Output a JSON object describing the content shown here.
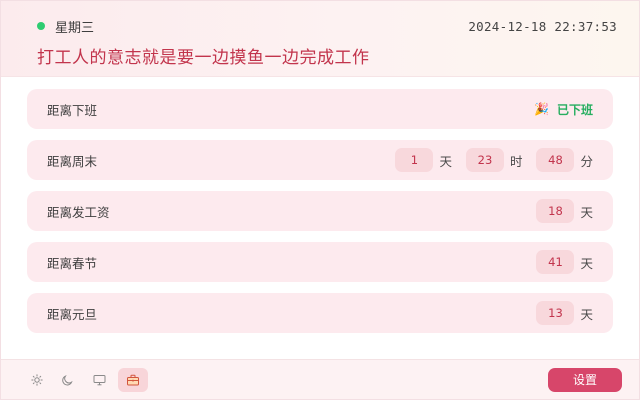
{
  "header": {
    "day": "星期三",
    "datetime": "2024-12-18 22:37:53",
    "slogan": "打工人的意志就是要一边摸鱼一边完成工作"
  },
  "rows": [
    {
      "label": "距离下班",
      "status_icon": "🎉",
      "status": "已下班"
    },
    {
      "label": "距离周末",
      "days": "1",
      "days_unit": "天",
      "hours": "23",
      "hours_unit": "时",
      "minutes": "48",
      "minutes_unit": "分"
    },
    {
      "label": "距离发工资",
      "value": "18",
      "unit": "天"
    },
    {
      "label": "距离春节",
      "value": "41",
      "unit": "天"
    },
    {
      "label": "距离元旦",
      "value": "13",
      "unit": "天"
    }
  ],
  "footer": {
    "theme_icons": [
      "sun-icon",
      "moon-icon",
      "monitor-icon",
      "briefcase-icon"
    ],
    "settings_label": "设置"
  },
  "colors": {
    "accent": "#d7466a",
    "slogan": "#c2344c",
    "status_green": "#27ae60",
    "row_bg": "#fdeaee"
  }
}
